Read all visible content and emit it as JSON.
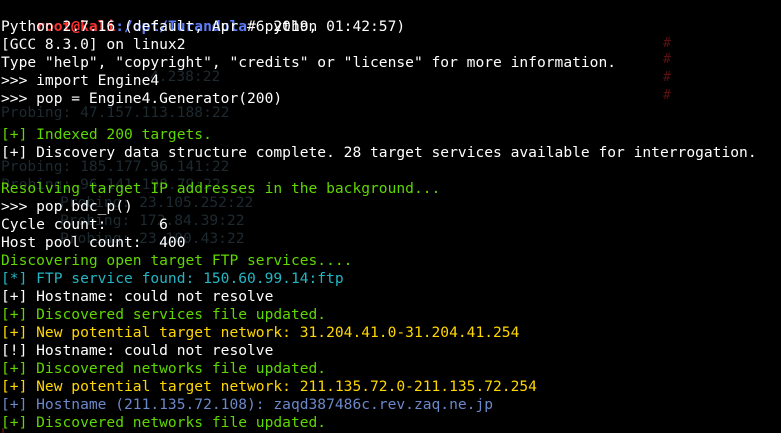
{
  "colors": {
    "white": "#ffffff",
    "green": "#5fd700",
    "yellow": "#ffd700",
    "cyan": "#24b5c3",
    "steel": "#6b88c9",
    "prompt_red": "#ff3333",
    "prompt_blue": "#5c7cfa"
  },
  "prompt": {
    "user_host": "root@kali",
    "path": ":/opt/Turandula",
    "symbol": "# ",
    "command": "python"
  },
  "lines": [
    {
      "text": "Python 2.7.16 (default, Apr  6 2019, 01:42:57)",
      "color": "white"
    },
    {
      "text": "[GCC 8.3.0] on linux2",
      "color": "white"
    },
    {
      "text": "Type \"help\", \"copyright\", \"credits\" or \"license\" for more information.",
      "color": "white"
    },
    {
      "text": ">>> import Engine4",
      "color": "white"
    },
    {
      "text": ">>> pop = Engine4.Generator(200)",
      "color": "white"
    },
    {
      "text": "",
      "color": "white"
    },
    {
      "text": "[+] Indexed 200 targets.",
      "color": "green"
    },
    {
      "text": "[+] Discovery data structure complete. 28 target services available for interrogation.",
      "color": "white"
    },
    {
      "text": "",
      "color": "white"
    },
    {
      "text": "Resolving target IP addresses in the background...",
      "color": "green"
    },
    {
      "text": ">>> pop.bdc_p()",
      "color": "white"
    },
    {
      "text": "Cycle count:      6",
      "color": "white"
    },
    {
      "text": "Host pool count:  400",
      "color": "white"
    },
    {
      "text": "Discovering open target FTP services....",
      "color": "green"
    },
    {
      "text": "[*] FTP service found: 150.60.99.14:ftp",
      "color": "cyan"
    },
    {
      "text": "[+] Hostname: could not resolve",
      "color": "white"
    },
    {
      "text": "[+] Discovered services file updated.",
      "color": "green"
    },
    {
      "text": "[+] New potential target network: 31.204.41.0-31.204.41.254",
      "color": "yellow"
    },
    {
      "text": "[!] Hostname: could not resolve",
      "color": "white"
    },
    {
      "text": "[+] Discovered networks file updated.",
      "color": "green"
    },
    {
      "text": "[+] New potential target network: 211.135.72.0-211.135.72.254",
      "color": "yellow"
    },
    {
      "text": "[+] Hostname (211.135.72.108): zaqd387486c.rev.zaq.ne.jp",
      "color": "steel"
    },
    {
      "text": "[+] Discovered networks file updated.",
      "color": "green"
    }
  ],
  "background_ghosts": [
    {
      "text": "4.238:22"
    },
    {
      "text": "Probing: 47.157.113.188:22"
    },
    {
      "text": "Probing: 185.177.96.141:22"
    },
    {
      "text": "Probing: 96.141.198.79:22"
    },
    {
      "text": "Probing: 23.105.252:22"
    },
    {
      "text": "Probing: 172.84.39:22"
    },
    {
      "text": "Probing: 23.100.43:22"
    }
  ]
}
